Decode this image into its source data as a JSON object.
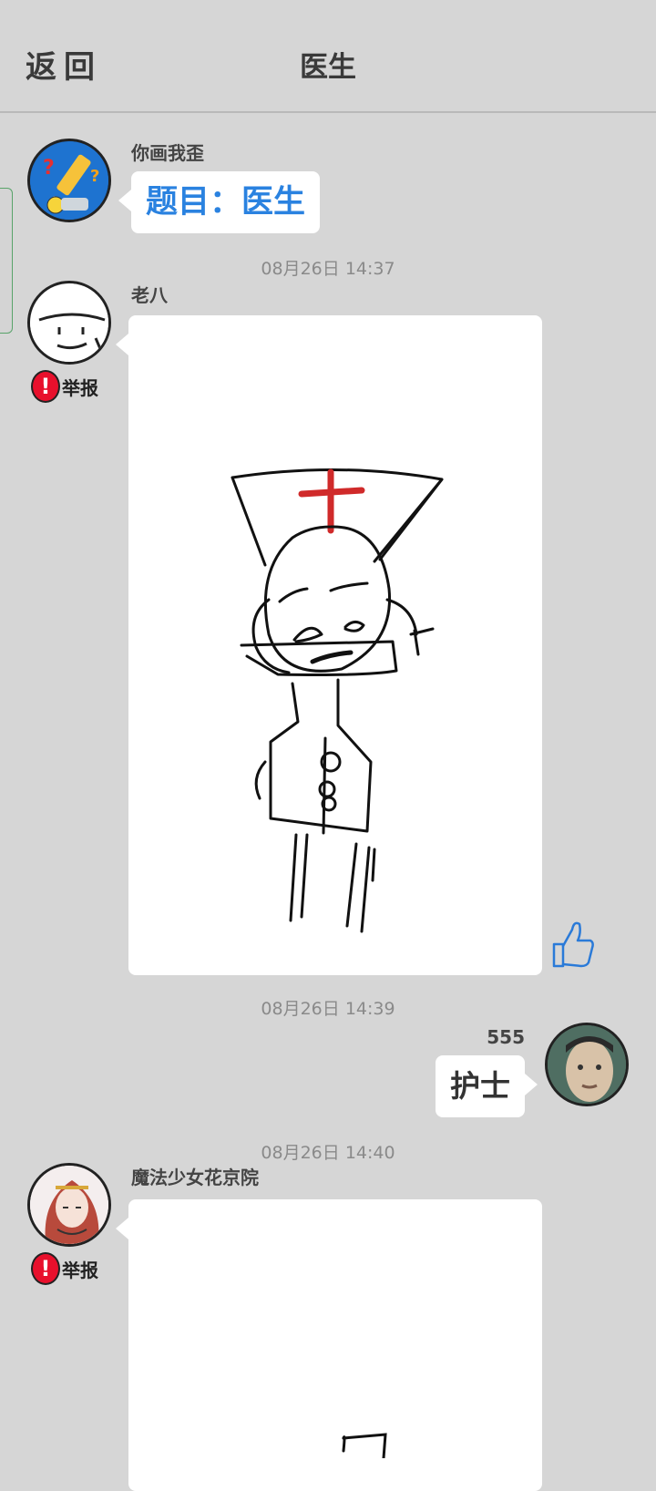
{
  "header": {
    "back_label": "返回",
    "title": "医生"
  },
  "messages": [
    {
      "sender": "你画我歪",
      "topic": "题目：医生"
    },
    {
      "timestamp": "08月26日  14:37",
      "sender": "老八",
      "report_label": "举报"
    },
    {
      "timestamp": "08月26日  14:39",
      "sender": "555",
      "answer": "护士"
    },
    {
      "timestamp": "08月26日  14:40",
      "sender": "魔法少女花京院",
      "report_label": "举报"
    }
  ],
  "icons": {
    "like": "thumbs-up-icon",
    "report": "exclamation-icon",
    "back": "back-text"
  },
  "colors": {
    "background": "#d6d6d6",
    "topic_text": "#2a82e0",
    "report_red": "#e8102c",
    "like_blue": "#2a7ad8",
    "drawing_cross": "#d02a2a"
  }
}
